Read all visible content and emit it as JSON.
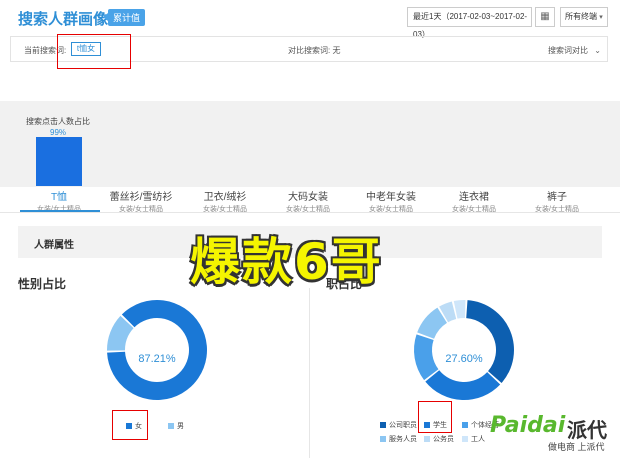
{
  "header": {
    "title": "搜索人群画像",
    "badge": "累计值",
    "date_range": "最近1天（2017-02-03~2017-02-03）",
    "calendar_icon": "calendar-icon",
    "terminal": "所有终端"
  },
  "filter": {
    "current_label": "当前搜索词:",
    "current_keyword": "t恤女",
    "compare_label": "对比搜索词: 无",
    "compare_toggle": "搜索词对比",
    "chevron_icon": "chevron-down-icon"
  },
  "bar_section": {
    "title": "搜索点击人数占比",
    "percent_label": "99%",
    "value": 99,
    "color": "#1a6fe0"
  },
  "tabs": [
    {
      "name": "T恤",
      "sub": "女装/女士精品"
    },
    {
      "name": "蕾丝衫/雪纺衫",
      "sub": "女装/女士精品"
    },
    {
      "name": "卫衣/绒衫",
      "sub": "女装/女士精品"
    },
    {
      "name": "大码女装",
      "sub": "女装/女士精品"
    },
    {
      "name": "中老年女装",
      "sub": "女装/女士精品"
    },
    {
      "name": "连衣裙",
      "sub": "女装/女士精品"
    },
    {
      "name": "裤子",
      "sub": "女装/女士精品"
    }
  ],
  "section": {
    "title": "人群属性"
  },
  "watermark": "爆款6哥",
  "gender": {
    "title": "性别占比",
    "center_label": "女",
    "center_value": "87.21%",
    "legend": [
      "女",
      "男"
    ]
  },
  "job": {
    "title_visible": "职占比",
    "center_label": "学生",
    "center_value": "27.60%",
    "legend": [
      "公司职员",
      "学生",
      "个体经营",
      "服务人员",
      "公务员",
      "工人"
    ]
  },
  "colors": {
    "accent": "#2f8fd6",
    "dark_blue": "#0d5fb0",
    "blue": "#1a78d6",
    "mid_blue": "#4aa0ea",
    "light_blue": "#8cc6f2",
    "pale_blue": "#cfe6fa",
    "highlight": "#e60000"
  },
  "logo": {
    "brand": "Paidai",
    "brand_zh": "派代",
    "tagline": "做电商 上派代"
  },
  "chart_data": [
    {
      "type": "bar",
      "title": "搜索点击人数占比",
      "categories": [
        "T恤"
      ],
      "values": [
        99
      ]
    },
    {
      "type": "pie",
      "title": "性别占比",
      "categories": [
        "女",
        "男"
      ],
      "values": [
        87.21,
        12.79
      ]
    },
    {
      "type": "pie",
      "title": "职业占比",
      "categories": [
        "公司职员",
        "学生",
        "个体经营",
        "服务人员",
        "公务员",
        "工人"
      ],
      "values": [
        36,
        27.6,
        16,
        11,
        5,
        4.4
      ]
    }
  ]
}
